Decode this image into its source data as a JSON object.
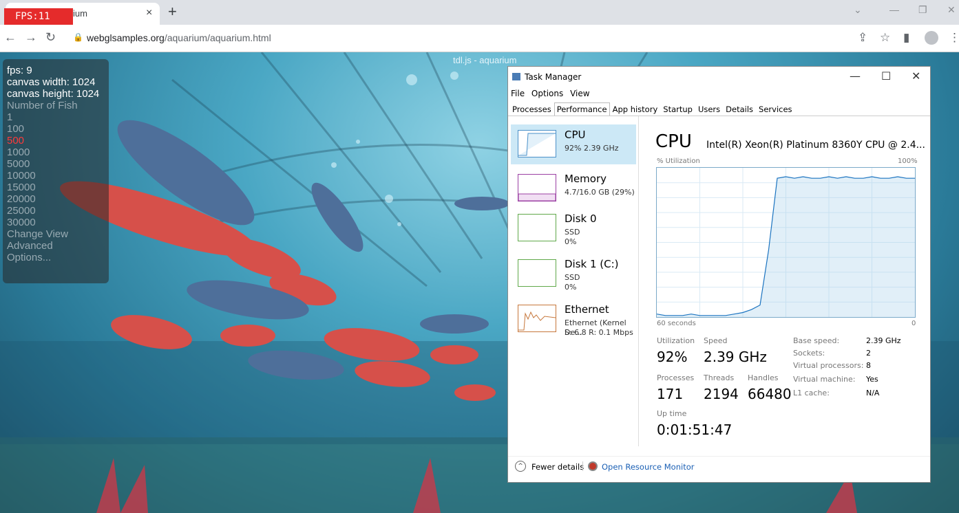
{
  "browser": {
    "tab_title": "ium",
    "fps_badge": "FPS:11",
    "url_host": "webglsamples.org",
    "url_path": "/aquarium/aquarium.html"
  },
  "scene": {
    "title": "tdl.js - aquarium",
    "stats": {
      "fps": "fps: 9",
      "canvas_width": "canvas width: 1024",
      "canvas_height": "canvas height: 1024",
      "number_of_fish": "Number of Fish",
      "fish_options": [
        "1",
        "100",
        "500",
        "1000",
        "5000",
        "10000",
        "15000",
        "20000",
        "25000",
        "30000"
      ],
      "selected_fish": "500",
      "change_view": "Change View",
      "advanced": "Advanced",
      "options": "Options..."
    }
  },
  "task_manager": {
    "title": "Task Manager",
    "menu": [
      "File",
      "Options",
      "View"
    ],
    "tabs": [
      "Processes",
      "Performance",
      "App history",
      "Startup",
      "Users",
      "Details",
      "Services"
    ],
    "active_tab": "Performance",
    "resources": [
      {
        "name": "CPU",
        "sub1": "92% 2.39 GHz",
        "sub2": "",
        "sub3": ""
      },
      {
        "name": "Memory",
        "sub1": "4.7/16.0 GB (29%)",
        "sub2": "",
        "sub3": ""
      },
      {
        "name": "Disk 0",
        "sub1": "SSD",
        "sub2": "0%",
        "sub3": ""
      },
      {
        "name": "Disk 1 (C:)",
        "sub1": "SSD",
        "sub2": "0%",
        "sub3": ""
      },
      {
        "name": "Ethernet",
        "sub1": "Ethernet (Kernel De...",
        "sub2": "S: 6.8 R: 0.1 Mbps",
        "sub3": ""
      }
    ],
    "cpu_heading": "CPU",
    "cpu_model": "Intel(R) Xeon(R) Platinum 8360Y CPU @ 2.4...",
    "util_label": "% Utilization",
    "util_max": "100%",
    "graph_left": "60 seconds",
    "graph_right": "0",
    "utilization_label": "Utilization",
    "utilization_value": "92%",
    "speed_label": "Speed",
    "speed_value": "2.39 GHz",
    "processes_label": "Processes",
    "processes_value": "171",
    "threads_label": "Threads",
    "threads_value": "2194",
    "handles_label": "Handles",
    "handles_value": "66480",
    "uptime_label": "Up time",
    "uptime_value": "0:01:51:47",
    "details": [
      {
        "label": "Base speed:",
        "value": "2.39 GHz"
      },
      {
        "label": "Sockets:",
        "value": "2"
      },
      {
        "label": "Virtual processors:",
        "value": "8"
      },
      {
        "label": "Virtual machine:",
        "value": "Yes"
      },
      {
        "label": "L1 cache:",
        "value": "N/A"
      }
    ],
    "fewer_details": "Fewer details",
    "open_resource_monitor": "Open Resource Monitor",
    "cpu_history": [
      2,
      1,
      1,
      1,
      2,
      1,
      1,
      1,
      1,
      2,
      3,
      5,
      8,
      45,
      93,
      94,
      93,
      94,
      93,
      93,
      94,
      93,
      94,
      93,
      93,
      94,
      93,
      93,
      94,
      93,
      93
    ]
  }
}
